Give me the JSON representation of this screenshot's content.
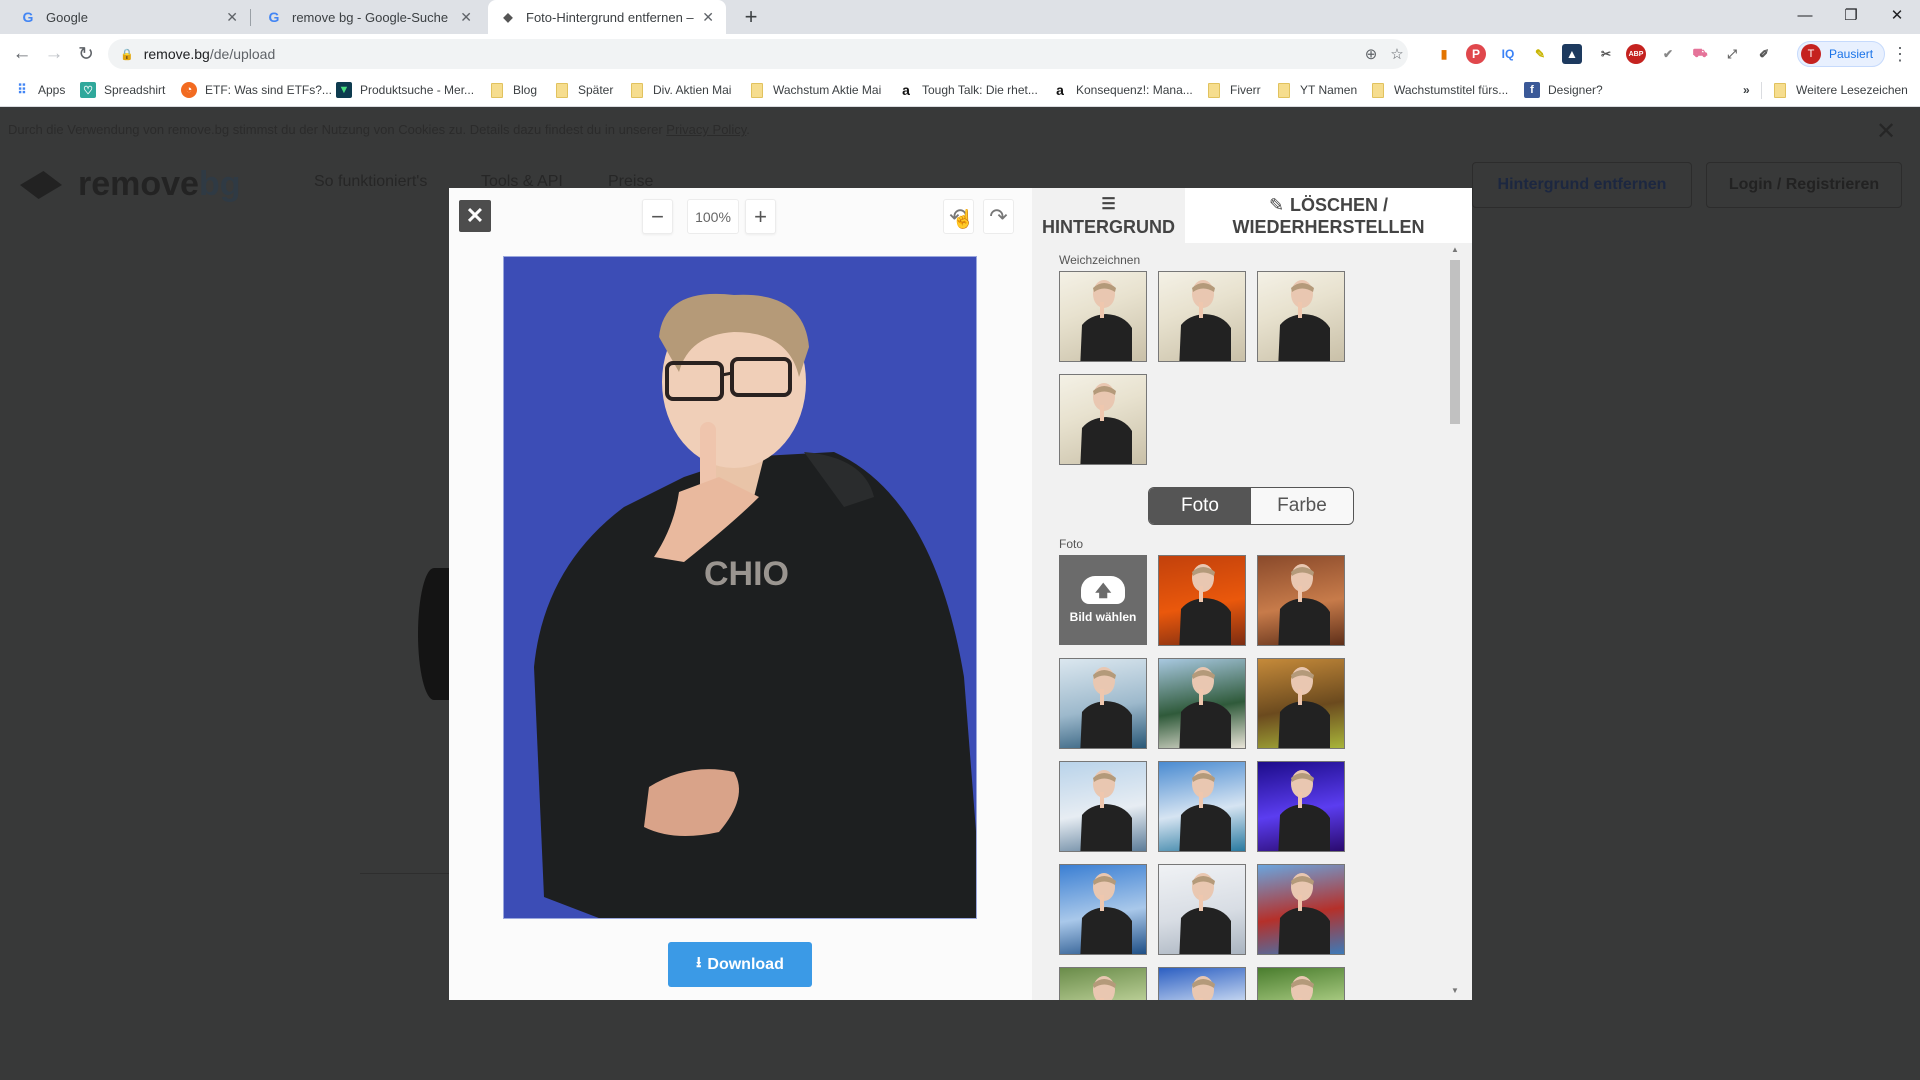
{
  "browser": {
    "tabs": [
      {
        "title": "Google",
        "favicon": "google-g",
        "active": false
      },
      {
        "title": "remove bg - Google-Suche",
        "favicon": "google-g",
        "active": false
      },
      {
        "title": "Foto-Hintergrund entfernen – re",
        "favicon": "removebg-logo",
        "active": true
      }
    ],
    "new_tab": "+",
    "window_controls": {
      "minimize": "—",
      "restore": "❐",
      "close": "✕"
    },
    "url_host": "remove.bg",
    "url_path": "/de/upload",
    "profile": {
      "initial": "T",
      "label": "Pausiert"
    },
    "extensions": [
      "zoom-icon",
      "star-icon",
      "ext-shirt",
      "ext-pinterest",
      "ext-iq",
      "ext-pen",
      "ext-profile",
      "ext-badge",
      "ext-abp",
      "ext-check",
      "ext-cart",
      "ext-expand",
      "ext-eyedropper"
    ],
    "bookmarks": [
      {
        "label": "Apps",
        "icon": "apps"
      },
      {
        "label": "Spreadshirt",
        "icon": "spreadshirt"
      },
      {
        "label": "ETF: Was sind ETFs?...",
        "icon": "etf"
      },
      {
        "label": "Produktsuche - Mer...",
        "icon": "merch"
      },
      {
        "label": "Blog",
        "icon": "folder"
      },
      {
        "label": "Später",
        "icon": "folder"
      },
      {
        "label": "Div. Aktien Mai",
        "icon": "folder"
      },
      {
        "label": "Wachstum Aktie Mai",
        "icon": "folder"
      },
      {
        "label": "Tough Talk: Die rhet...",
        "icon": "amazon"
      },
      {
        "label": "Konsequenz!: Mana...",
        "icon": "amazon"
      },
      {
        "label": "Fiverr",
        "icon": "folder"
      },
      {
        "label": "YT Namen",
        "icon": "folder"
      },
      {
        "label": "Wachstumstitel fürs...",
        "icon": "folder"
      },
      {
        "label": "Designer?",
        "icon": "facebook"
      }
    ],
    "bookmarks_overflow": "»",
    "other_bookmarks": "Weitere Lesezeichen"
  },
  "page": {
    "cookie_text": "Durch die Verwendung von remove.bg stimmst du der Nutzung von Cookies zu. Details dazu findest du in unserer ",
    "cookie_link": "Privacy Policy",
    "cookie_suffix": ".",
    "logo_word1": "remove",
    "logo_word2": "bg",
    "nav": [
      "So funktioniert's",
      "Tools & API",
      "Preise"
    ],
    "btn_remove": "Hintergrund entfernen",
    "btn_login": "Login / Registrieren"
  },
  "modal": {
    "close": "✕",
    "zoom_out": "−",
    "zoom_level": "100%",
    "zoom_in": "+",
    "undo": "↶",
    "redo": "↷",
    "download_label": "Download",
    "preview_bg_color": "#3c4db6",
    "shirt_text": "CHIO",
    "tabs": [
      {
        "label": "HINTERGRUND",
        "icon": "layers-icon",
        "active": true
      },
      {
        "label_line1": "LÖSCHEN /",
        "label_line2": "WIEDERHERSTELLEN",
        "icon": "brush-icon",
        "active": false
      }
    ],
    "blur_label": "Weichzeichnen",
    "blur_thumbs": 4,
    "toggle": {
      "photo": "Foto",
      "color": "Farbe",
      "selected": "Foto"
    },
    "photo_label": "Foto",
    "upload_label": "Bild wählen",
    "photo_backgrounds": [
      {
        "name": "autumn-forest",
        "colors": [
          "#c2410c",
          "#ea580c",
          "#7c2d12"
        ]
      },
      {
        "name": "wooden-slats",
        "colors": [
          "#8a4a2b",
          "#c77b4a",
          "#5e2f19"
        ]
      },
      {
        "name": "mountain-lake",
        "colors": [
          "#dbe7ef",
          "#9db9cc",
          "#2a5877"
        ]
      },
      {
        "name": "palm-beach",
        "colors": [
          "#a8c8e0",
          "#2f5a3a",
          "#e8e4d8"
        ]
      },
      {
        "name": "tropical-hut",
        "colors": [
          "#c58a3a",
          "#6b4a1e",
          "#a8b53a"
        ]
      },
      {
        "name": "coastal-city",
        "colors": [
          "#b9d3ea",
          "#e7edf3",
          "#5d7d99"
        ]
      },
      {
        "name": "ocean-beach",
        "colors": [
          "#4a8bd1",
          "#d6e4f2",
          "#2a7aa0"
        ]
      },
      {
        "name": "purple-lights",
        "colors": [
          "#1d0c8a",
          "#5b3df0",
          "#2a0a6e"
        ]
      },
      {
        "name": "city-skyline",
        "colors": [
          "#3b7fd3",
          "#a9c8ea",
          "#1f4f86"
        ]
      },
      {
        "name": "white-city",
        "colors": [
          "#f0f2f5",
          "#d8dde4",
          "#aab4c0"
        ]
      },
      {
        "name": "golden-gate",
        "colors": [
          "#6aa5de",
          "#b5302a",
          "#3d7ab8"
        ]
      },
      {
        "name": "green-forest",
        "colors": [
          "#6a8c4a",
          "#c9dba4",
          "#2f4a22"
        ]
      },
      {
        "name": "blue-sky-tree",
        "colors": [
          "#2c5fc2",
          "#e1ecf9",
          "#5a8a3a"
        ]
      },
      {
        "name": "green-leaves",
        "colors": [
          "#4a7d2e",
          "#b9d890",
          "#e6efd6"
        ]
      }
    ]
  }
}
